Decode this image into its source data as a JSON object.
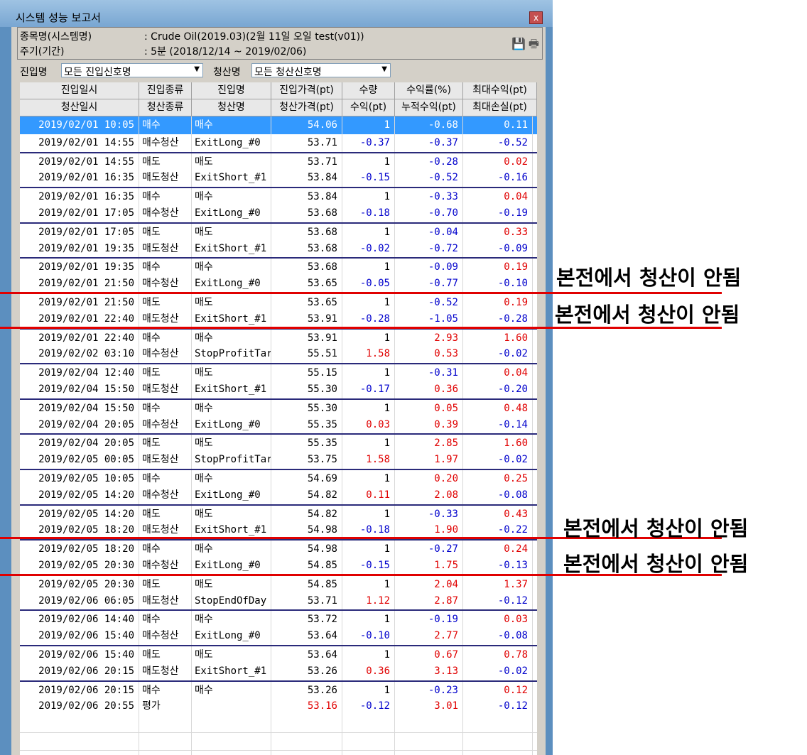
{
  "window": {
    "title": "시스템 성능 보고서",
    "close_label": "x"
  },
  "info": {
    "name_label": "종목명(시스템명)",
    "name_value": ": Crude Oil(2019.03)(2월 11일 오일 test(v01))",
    "period_label": "주기(기간)",
    "period_value": ": 5분 (2018/12/14 ~ 2019/02/06)"
  },
  "filter": {
    "entry_label": "진입명",
    "entry_value": "모든 진입신호명",
    "exit_label": "청산명",
    "exit_value": "모든 청산신호명"
  },
  "headers": {
    "row1": [
      "진입일시",
      "진입종류",
      "진입명",
      "진입가격(pt)",
      "수량",
      "수익률(%)",
      "최대수익(pt)"
    ],
    "row2": [
      "청산일시",
      "청산종류",
      "청산명",
      "청산가격(pt)",
      "수익(pt)",
      "누적수익(pt)",
      "최대손실(pt)"
    ]
  },
  "rows": [
    {
      "c": [
        "2019/02/01 10:05",
        "매수",
        "매수",
        "54.06",
        "1",
        "-0.68",
        "0.11"
      ],
      "col": [
        "black",
        "black",
        "black",
        "black",
        "blue",
        "blue",
        "blue"
      ],
      "sel": true
    },
    {
      "c": [
        "2019/02/01 14:55",
        "매수청산",
        "ExitLong_#0",
        "53.71",
        "-0.37",
        "-0.37",
        "-0.52"
      ],
      "col": [
        "black",
        "black",
        "black",
        "black",
        "blue",
        "blue",
        "blue"
      ]
    },
    {
      "c": [
        "2019/02/01 14:55",
        "매도",
        "매도",
        "53.71",
        "1",
        "-0.28",
        "0.02"
      ],
      "col": [
        "black",
        "black",
        "black",
        "black",
        "black",
        "blue",
        "red"
      ]
    },
    {
      "c": [
        "2019/02/01 16:35",
        "매도청산",
        "ExitShort_#1",
        "53.84",
        "-0.15",
        "-0.52",
        "-0.16"
      ],
      "col": [
        "black",
        "black",
        "black",
        "black",
        "blue",
        "blue",
        "blue"
      ]
    },
    {
      "c": [
        "2019/02/01 16:35",
        "매수",
        "매수",
        "53.84",
        "1",
        "-0.33",
        "0.04"
      ],
      "col": [
        "black",
        "black",
        "black",
        "black",
        "black",
        "blue",
        "red"
      ]
    },
    {
      "c": [
        "2019/02/01 17:05",
        "매수청산",
        "ExitLong_#0",
        "53.68",
        "-0.18",
        "-0.70",
        "-0.19"
      ],
      "col": [
        "black",
        "black",
        "black",
        "black",
        "blue",
        "blue",
        "blue"
      ]
    },
    {
      "c": [
        "2019/02/01 17:05",
        "매도",
        "매도",
        "53.68",
        "1",
        "-0.04",
        "0.33"
      ],
      "col": [
        "black",
        "black",
        "black",
        "black",
        "black",
        "blue",
        "red"
      ]
    },
    {
      "c": [
        "2019/02/01 19:35",
        "매도청산",
        "ExitShort_#1",
        "53.68",
        "-0.02",
        "-0.72",
        "-0.09"
      ],
      "col": [
        "black",
        "black",
        "black",
        "black",
        "blue",
        "blue",
        "blue"
      ]
    },
    {
      "c": [
        "2019/02/01 19:35",
        "매수",
        "매수",
        "53.68",
        "1",
        "-0.09",
        "0.19"
      ],
      "col": [
        "black",
        "black",
        "black",
        "black",
        "black",
        "blue",
        "red"
      ]
    },
    {
      "c": [
        "2019/02/01 21:50",
        "매수청산",
        "ExitLong_#0",
        "53.65",
        "-0.05",
        "-0.77",
        "-0.10"
      ],
      "col": [
        "black",
        "black",
        "black",
        "black",
        "blue",
        "blue",
        "blue"
      ]
    },
    {
      "c": [
        "2019/02/01 21:50",
        "매도",
        "매도",
        "53.65",
        "1",
        "-0.52",
        "0.19"
      ],
      "col": [
        "black",
        "black",
        "black",
        "black",
        "black",
        "blue",
        "red"
      ]
    },
    {
      "c": [
        "2019/02/01 22:40",
        "매도청산",
        "ExitShort_#1",
        "53.91",
        "-0.28",
        "-1.05",
        "-0.28"
      ],
      "col": [
        "black",
        "black",
        "black",
        "black",
        "blue",
        "blue",
        "blue"
      ]
    },
    {
      "c": [
        "2019/02/01 22:40",
        "매수",
        "매수",
        "53.91",
        "1",
        "2.93",
        "1.60"
      ],
      "col": [
        "black",
        "black",
        "black",
        "black",
        "black",
        "red",
        "red"
      ]
    },
    {
      "c": [
        "2019/02/02 03:10",
        "매수청산",
        "StopProfitTar:",
        "55.51",
        "1.58",
        "0.53",
        "-0.02"
      ],
      "col": [
        "black",
        "black",
        "black",
        "black",
        "red",
        "red",
        "blue"
      ]
    },
    {
      "c": [
        "2019/02/04 12:40",
        "매도",
        "매도",
        "55.15",
        "1",
        "-0.31",
        "0.04"
      ],
      "col": [
        "black",
        "black",
        "black",
        "black",
        "black",
        "blue",
        "red"
      ]
    },
    {
      "c": [
        "2019/02/04 15:50",
        "매도청산",
        "ExitShort_#1",
        "55.30",
        "-0.17",
        "0.36",
        "-0.20"
      ],
      "col": [
        "black",
        "black",
        "black",
        "black",
        "blue",
        "red",
        "blue"
      ]
    },
    {
      "c": [
        "2019/02/04 15:50",
        "매수",
        "매수",
        "55.30",
        "1",
        "0.05",
        "0.48"
      ],
      "col": [
        "black",
        "black",
        "black",
        "black",
        "black",
        "red",
        "red"
      ]
    },
    {
      "c": [
        "2019/02/04 20:05",
        "매수청산",
        "ExitLong_#0",
        "55.35",
        "0.03",
        "0.39",
        "-0.14"
      ],
      "col": [
        "black",
        "black",
        "black",
        "black",
        "red",
        "red",
        "blue"
      ]
    },
    {
      "c": [
        "2019/02/04 20:05",
        "매도",
        "매도",
        "55.35",
        "1",
        "2.85",
        "1.60"
      ],
      "col": [
        "black",
        "black",
        "black",
        "black",
        "black",
        "red",
        "red"
      ]
    },
    {
      "c": [
        "2019/02/05 00:05",
        "매도청산",
        "StopProfitTar:",
        "53.75",
        "1.58",
        "1.97",
        "-0.02"
      ],
      "col": [
        "black",
        "black",
        "black",
        "black",
        "red",
        "red",
        "blue"
      ]
    },
    {
      "c": [
        "2019/02/05 10:05",
        "매수",
        "매수",
        "54.69",
        "1",
        "0.20",
        "0.25"
      ],
      "col": [
        "black",
        "black",
        "black",
        "black",
        "black",
        "red",
        "red"
      ]
    },
    {
      "c": [
        "2019/02/05 14:20",
        "매수청산",
        "ExitLong_#0",
        "54.82",
        "0.11",
        "2.08",
        "-0.08"
      ],
      "col": [
        "black",
        "black",
        "black",
        "black",
        "red",
        "red",
        "blue"
      ]
    },
    {
      "c": [
        "2019/02/05 14:20",
        "매도",
        "매도",
        "54.82",
        "1",
        "-0.33",
        "0.43"
      ],
      "col": [
        "black",
        "black",
        "black",
        "black",
        "black",
        "blue",
        "red"
      ]
    },
    {
      "c": [
        "2019/02/05 18:20",
        "매도청산",
        "ExitShort_#1",
        "54.98",
        "-0.18",
        "1.90",
        "-0.22"
      ],
      "col": [
        "black",
        "black",
        "black",
        "black",
        "blue",
        "red",
        "blue"
      ]
    },
    {
      "c": [
        "2019/02/05 18:20",
        "매수",
        "매수",
        "54.98",
        "1",
        "-0.27",
        "0.24"
      ],
      "col": [
        "black",
        "black",
        "black",
        "black",
        "black",
        "blue",
        "red"
      ]
    },
    {
      "c": [
        "2019/02/05 20:30",
        "매수청산",
        "ExitLong_#0",
        "54.85",
        "-0.15",
        "1.75",
        "-0.13"
      ],
      "col": [
        "black",
        "black",
        "black",
        "black",
        "blue",
        "red",
        "blue"
      ]
    },
    {
      "c": [
        "2019/02/05 20:30",
        "매도",
        "매도",
        "54.85",
        "1",
        "2.04",
        "1.37"
      ],
      "col": [
        "black",
        "black",
        "black",
        "black",
        "black",
        "red",
        "red"
      ]
    },
    {
      "c": [
        "2019/02/06 06:05",
        "매도청산",
        "StopEndOfDay",
        "53.71",
        "1.12",
        "2.87",
        "-0.12"
      ],
      "col": [
        "black",
        "black",
        "black",
        "black",
        "red",
        "red",
        "blue"
      ]
    },
    {
      "c": [
        "2019/02/06 14:40",
        "매수",
        "매수",
        "53.72",
        "1",
        "-0.19",
        "0.03"
      ],
      "col": [
        "black",
        "black",
        "black",
        "black",
        "black",
        "blue",
        "red"
      ]
    },
    {
      "c": [
        "2019/02/06 15:40",
        "매수청산",
        "ExitLong_#0",
        "53.64",
        "-0.10",
        "2.77",
        "-0.08"
      ],
      "col": [
        "black",
        "black",
        "black",
        "black",
        "blue",
        "red",
        "blue"
      ]
    },
    {
      "c": [
        "2019/02/06 15:40",
        "매도",
        "매도",
        "53.64",
        "1",
        "0.67",
        "0.78"
      ],
      "col": [
        "black",
        "black",
        "black",
        "black",
        "black",
        "red",
        "red"
      ]
    },
    {
      "c": [
        "2019/02/06 20:15",
        "매도청산",
        "ExitShort_#1",
        "53.26",
        "0.36",
        "3.13",
        "-0.02"
      ],
      "col": [
        "black",
        "black",
        "black",
        "black",
        "red",
        "red",
        "blue"
      ]
    },
    {
      "c": [
        "2019/02/06 20:15",
        "매수",
        "매수",
        "53.26",
        "1",
        "-0.23",
        "0.12"
      ],
      "col": [
        "black",
        "black",
        "black",
        "black",
        "black",
        "blue",
        "red"
      ]
    },
    {
      "c": [
        "2019/02/06 20:55",
        "평가",
        "",
        "53.16",
        "-0.12",
        "3.01",
        "-0.12"
      ],
      "col": [
        "black",
        "black",
        "black",
        "red",
        "blue",
        "red",
        "blue"
      ]
    }
  ],
  "annotations": [
    "본전에서 청산이 안됨",
    "본전에서 청산이 안됨",
    "본전에서 청산이 안됨",
    "본전에서 청산이 안됨"
  ]
}
